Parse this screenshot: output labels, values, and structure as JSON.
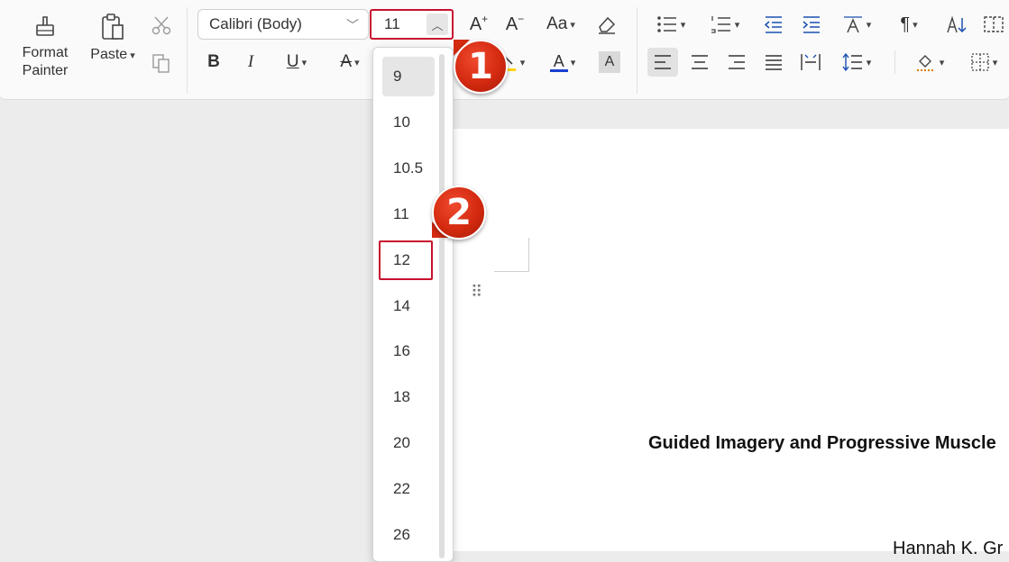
{
  "clipboard": {
    "format_painter_line1": "Format",
    "format_painter_line2": "Painter",
    "paste_label": "Paste"
  },
  "font": {
    "family": "Calibri (Body)",
    "size": "11"
  },
  "format": {
    "bold": "B",
    "italic": "I",
    "underline": "U",
    "strikethrough": "A",
    "font_color_glyph": "A",
    "highlight_glyph": "A",
    "grow_glyph": "A",
    "shrink_glyph": "A",
    "change_case": "Aa",
    "paragraph_mark": "¶"
  },
  "font_size_dropdown": {
    "items": [
      "9",
      "10",
      "10.5",
      "11",
      "12",
      "14",
      "16",
      "18",
      "20",
      "22",
      "26"
    ],
    "selected": "9",
    "highlighted": "12"
  },
  "markers": {
    "step1": "1",
    "step2": "2"
  },
  "document": {
    "title": "Guided Imagery and Progressive Muscle",
    "author": "Hannah K. Gr"
  },
  "colors": {
    "accent_red": "#c8102e",
    "font_color_underline": "#1a3fcf",
    "highlight_yellow": "#ffd400"
  }
}
